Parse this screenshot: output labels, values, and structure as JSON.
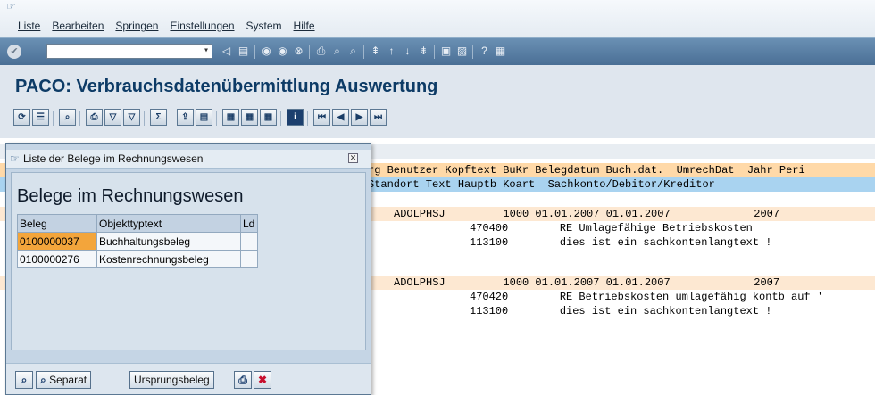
{
  "menubar": {
    "items": [
      "Liste",
      "Bearbeiten",
      "Springen",
      "Einstellungen",
      "System",
      "Hilfe"
    ]
  },
  "toolbar": {
    "command_value": "",
    "icons": [
      "enter-icon",
      "back-icon",
      "save-icon",
      "back-nav-icon",
      "exit-icon",
      "cancel-icon",
      "print-icon",
      "find-icon",
      "find-next-icon",
      "first-page-icon",
      "prev-page-icon",
      "next-page-icon",
      "last-page-icon",
      "new-session-icon",
      "shortcut-icon",
      "help-icon",
      "layout-icon"
    ]
  },
  "page": {
    "title": "PACO: Verbrauchsdatenübermittlung Auswertung"
  },
  "apptoolbar": {
    "icons": [
      "refresh-icon",
      "choose-icon",
      "detail-icon",
      "print-icon",
      "filter-icon",
      "filter-remove-icon",
      "sum-icon",
      "export-icon",
      "view-icon",
      "grid-icon",
      "layout-select-icon",
      "layout-save-icon",
      "info-icon",
      "first-icon",
      "prev-icon",
      "next-icon",
      "last-icon"
    ]
  },
  "list": {
    "header1": "rg Benutzer Kopftext BuKr Belegdatum Buch.dat.  UmrechDat  Jahr Peri",
    "header2": "Standort Text Hauptb Koart  Sachkonto/Debitor/Kreditor",
    "blocks": [
      {
        "head": "ADOLPHSJ         1000 01.01.2007 01.01.2007             2007",
        "lines": [
          "470400        RE Umlagefähige Betriebskosten",
          "113100        dies ist ein sachkontenlangtext !"
        ]
      },
      {
        "head": "ADOLPHSJ         1000 01.01.2007 01.01.2007             2007",
        "lines": [
          "470420        RE Betriebskosten umlagefähig kontb auf '",
          "113100        dies ist ein sachkontenlangtext !"
        ]
      }
    ]
  },
  "dialog": {
    "title": "Liste der Belege im Rechnungswesen",
    "heading": "Belege im Rechnungswesen",
    "columns": [
      "Beleg",
      "Objekttyptext",
      "Ld"
    ],
    "rows": [
      {
        "beleg": "0100000037",
        "objekttyp": "Buchhaltungsbeleg",
        "ld": ""
      },
      {
        "beleg": "0100000276",
        "objekttyp": "Kostenrechnungsbeleg",
        "ld": ""
      }
    ],
    "buttons": {
      "separat": "Separat",
      "ursprung": "Ursprungsbeleg"
    }
  }
}
